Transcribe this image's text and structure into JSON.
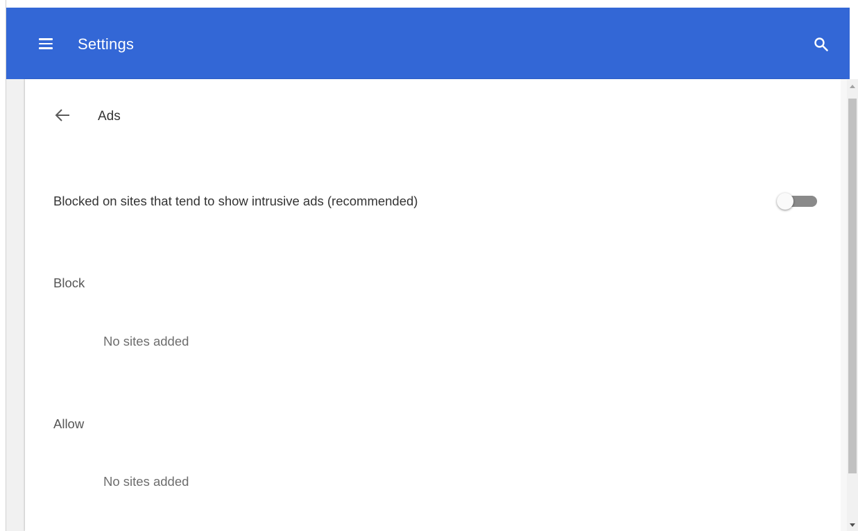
{
  "toolbar": {
    "title": "Settings",
    "background_color": "#3367d6",
    "menu_icon": "hamburger-menu-icon",
    "search_icon": "search-icon"
  },
  "subpage": {
    "back_icon": "arrow-back-icon",
    "title": "Ads"
  },
  "setting": {
    "label": "Blocked on sites that tend to show intrusive ads (recommended)",
    "toggle_on": false
  },
  "block_section": {
    "heading": "Block",
    "empty_text": "No sites added"
  },
  "allow_section": {
    "heading": "Allow",
    "empty_text": "No sites added"
  }
}
